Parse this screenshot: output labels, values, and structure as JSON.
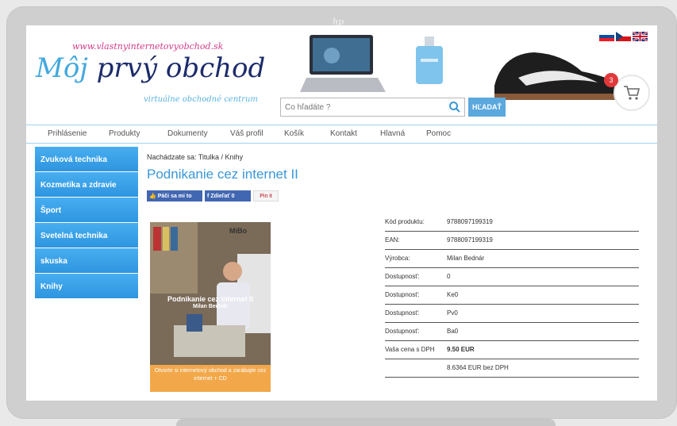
{
  "brand": {
    "laptop_logo": "hp"
  },
  "header": {
    "logo_url": "www.vlastnyinternetovyobchod.sk",
    "logo_part1": "Môj",
    "logo_part2": " prvý obchod",
    "logo_sub": "virtuálne obchodné centrum",
    "cart_count": "3"
  },
  "search": {
    "placeholder": "Čo hľadáte ?",
    "button": "HĽADAŤ"
  },
  "nav": {
    "items": [
      "Prihlásenie",
      "Produkty",
      "Dokumenty",
      "Váš profil",
      "Košík",
      "Kontakt",
      "Hlavná",
      "Pomoc"
    ]
  },
  "sidebar": {
    "items": [
      "Zvuková technika",
      "Kozmetika a zdravie",
      "Šport",
      "Svetelná technika",
      "skuska",
      "Knihy"
    ]
  },
  "breadcrumb": "Nachádzate sa: Titulka / Knihy",
  "product": {
    "title": "Podnikanie cez internet II",
    "social": {
      "like": "Páči sa mi to",
      "share": "Zdieľať 0",
      "pin": "Pin it"
    },
    "cover": {
      "brand": "MiBo",
      "title": "Podnikanie cez internet II",
      "author": "Milan Bednár",
      "tagline": "Otvorte si internetový obchod a zarábajte cez internet + CD"
    },
    "details": [
      {
        "label": "Kód produktu:",
        "value": "9788097199319"
      },
      {
        "label": "EAN:",
        "value": "9788097199319"
      },
      {
        "label": "Výrobca:",
        "value": "Milan Bednár"
      },
      {
        "label": "Dostupnosť:",
        "value": "0"
      },
      {
        "label": "Dostupnosť:",
        "value": "Ke0"
      },
      {
        "label": "Dostupnosť:",
        "value": "Pv0"
      },
      {
        "label": "Dostupnosť:",
        "value": "Ba0"
      }
    ],
    "price_label": "Vaša cena s DPH",
    "price": "9.50 EUR",
    "price_no_vat": "8.6364 EUR  bez DPH"
  },
  "colors": {
    "accent": "#3a97d8",
    "sidebar": "#2e95e0",
    "cart_badge": "#e2393a"
  }
}
